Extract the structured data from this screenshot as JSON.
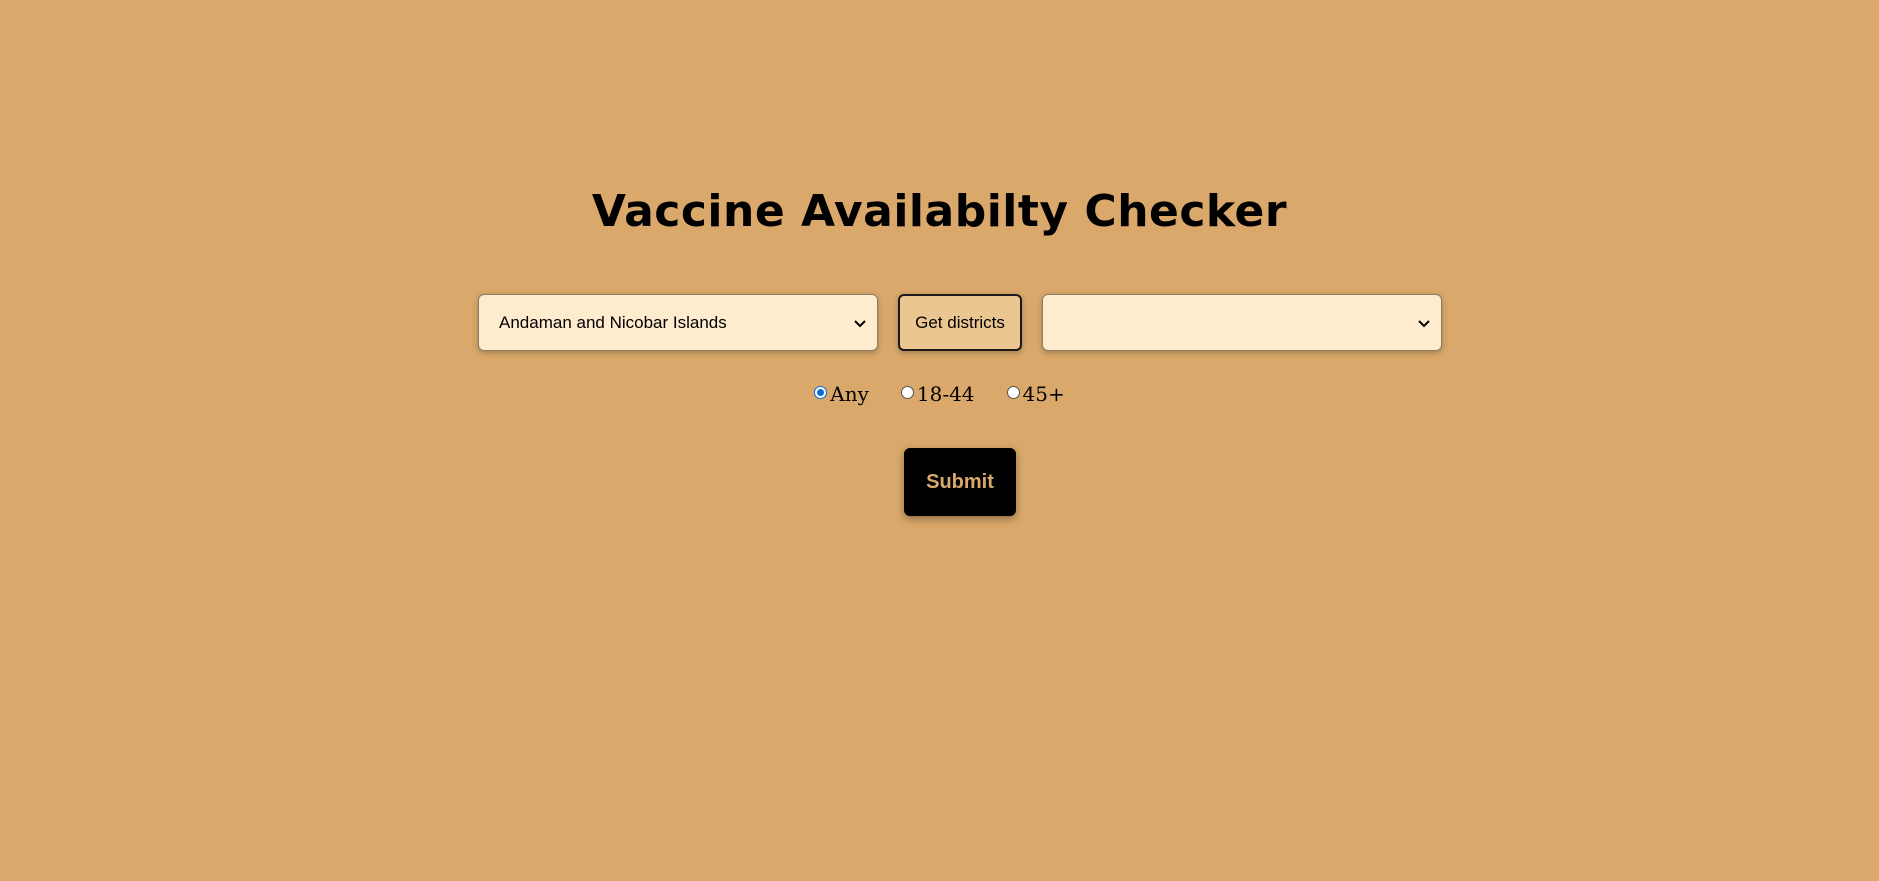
{
  "page": {
    "title": "Vaccine Availabilty Checker",
    "background_color": "#d9a86a"
  },
  "form": {
    "state_select": {
      "selected": "Andaman and Nicobar Islands"
    },
    "get_districts_label": "Get districts",
    "district_select": {
      "selected": ""
    },
    "age_options": [
      {
        "label": "Any",
        "checked": true
      },
      {
        "label": "18-44",
        "checked": false
      },
      {
        "label": "45+",
        "checked": false
      }
    ],
    "submit_label": "Submit"
  },
  "icons": {
    "select_arrow": "chevron-down-icon"
  }
}
